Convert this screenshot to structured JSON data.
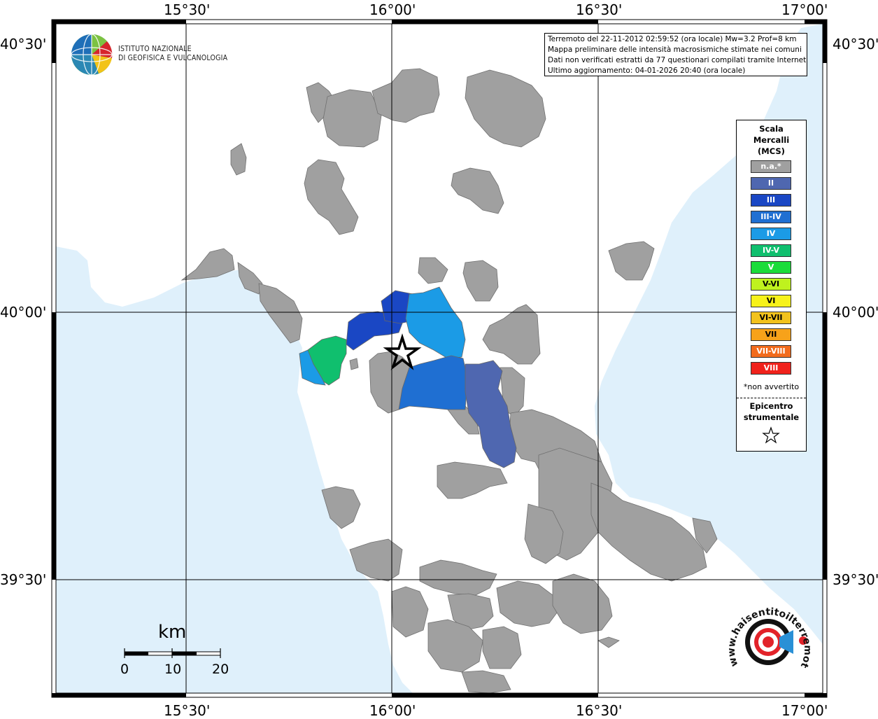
{
  "header": {
    "info_lines": [
      "Terremoto del 22-11-2012 02:59:52 (ora locale) Mw=3.2 Prof=8 km",
      "Mappa preliminare delle intensità macrosismiche stimate nei comuni",
      "Dati non verificati estratti da 77 questionari compilati tramite Internet.",
      "Ultimo aggiornamento: 04-01-2026 20:40 (ora locale)"
    ]
  },
  "logo": {
    "org_line1": "ISTITUTO NAZIONALE",
    "org_line2": "DI GEOFISICA E VULCANOLOGIA",
    "icon": "globe-logo-icon"
  },
  "axes": {
    "longitude_ticks": [
      "15°30'",
      "16°00'",
      "16°30'",
      "17°00'"
    ],
    "latitude_ticks": [
      "40°30'",
      "40°00'",
      "39°30'"
    ]
  },
  "legend": {
    "title_line1": "Scala",
    "title_line2": "Mercalli",
    "title_line3": "(MCS)",
    "items": [
      {
        "label": "n.a.*",
        "color": "#a0a0a0"
      },
      {
        "label": "II",
        "color": "#4f67b0"
      },
      {
        "label": "III",
        "color": "#1a47c4"
      },
      {
        "label": "III-IV",
        "color": "#1f6fd2"
      },
      {
        "label": "IV",
        "color": "#1b9be6"
      },
      {
        "label": "IV-V",
        "color": "#10bf6e"
      },
      {
        "label": "V",
        "color": "#1bdc3a"
      },
      {
        "label": "V-VI",
        "color": "#bff21e"
      },
      {
        "label": "VI",
        "color": "#f7f21a"
      },
      {
        "label": "VI-VII",
        "color": "#f2c21d"
      },
      {
        "label": "VII",
        "color": "#f7a21a"
      },
      {
        "label": "VII-VIII",
        "color": "#f26b1c"
      },
      {
        "label": "VIII",
        "color": "#f0221c"
      }
    ],
    "note": "*non avvertito",
    "epicenter_line1": "Epicentro",
    "epicenter_line2": "strumentale",
    "epicenter_icon": "star-icon"
  },
  "scale_bar": {
    "unit": "km",
    "labels": [
      "0",
      "10",
      "20"
    ]
  },
  "watermark": {
    "text": "www.haisentitoilterremoto.it",
    "icon": "haisentito-logo-icon"
  },
  "colors": {
    "sea": "#dff0fb",
    "land": "#ffffff",
    "not_felt": "#a0a0a0"
  }
}
